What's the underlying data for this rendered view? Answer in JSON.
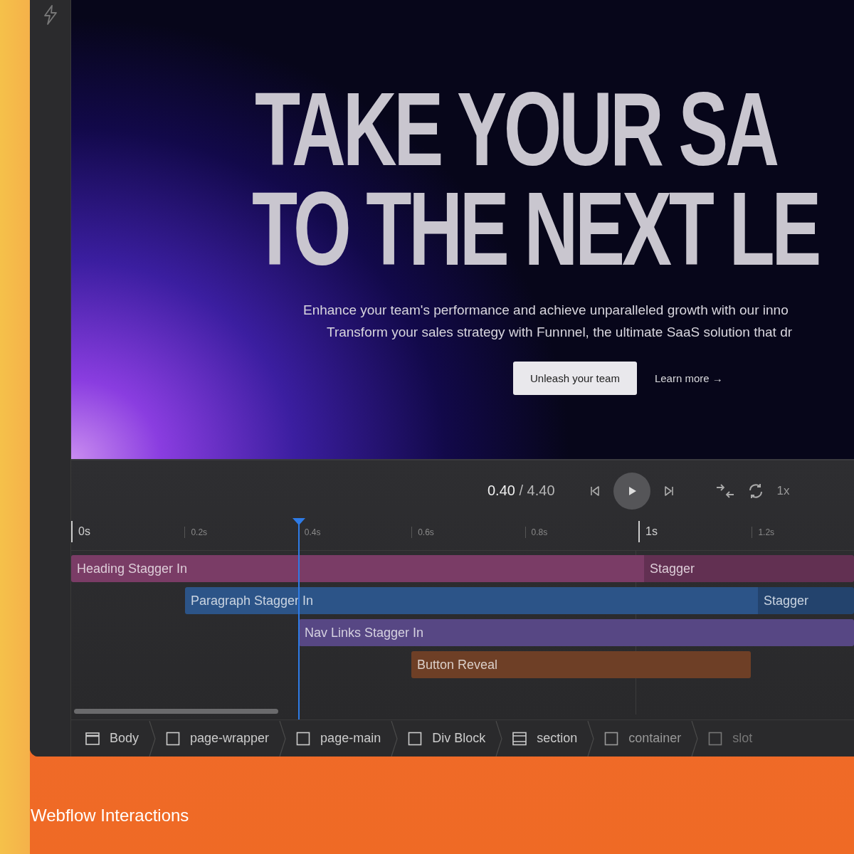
{
  "preview": {
    "headline": [
      "TAKE YOUR SA",
      "TO THE NEXT LE"
    ],
    "paragraph": [
      "Enhance your team's performance and achieve unparalleled growth with our inno",
      "Transform your sales strategy with Funnnel, the ultimate SaaS solution that dr"
    ],
    "primary_button": "Unleash your team",
    "link": "Learn more",
    "link_arrow": "→"
  },
  "timeline": {
    "current_time": "0.40",
    "separator": "/",
    "total_time": "4.40",
    "speed": "1x",
    "ticks": [
      {
        "label": "0s",
        "major": true
      },
      {
        "label": "0.2s",
        "major": false
      },
      {
        "label": "0.4s",
        "major": false
      },
      {
        "label": "0.6s",
        "major": false
      },
      {
        "label": "0.8s",
        "major": false
      },
      {
        "label": "1s",
        "major": true
      },
      {
        "label": "1.2s",
        "major": false
      }
    ],
    "tracks": [
      {
        "color": "#7a3c66",
        "segments": [
          "Heading Stagger In",
          "Stagger"
        ]
      },
      {
        "color": "#2c5488",
        "segments": [
          "Paragraph Stagger In",
          "Stagger"
        ]
      },
      {
        "color": "#574784",
        "segments": [
          "Nav Links Stagger In"
        ]
      },
      {
        "color": "#6e3f26",
        "segments": [
          "Button Reveal"
        ]
      }
    ]
  },
  "breadcrumb": [
    {
      "kind": "body",
      "label": "Body"
    },
    {
      "kind": "box",
      "label": "page-wrapper"
    },
    {
      "kind": "box",
      "label": "page-main"
    },
    {
      "kind": "box",
      "label": "Div Block"
    },
    {
      "kind": "section",
      "label": "section"
    },
    {
      "kind": "box",
      "label": "container"
    },
    {
      "kind": "box",
      "label": "slot"
    }
  ],
  "caption": "Webflow Interactions"
}
